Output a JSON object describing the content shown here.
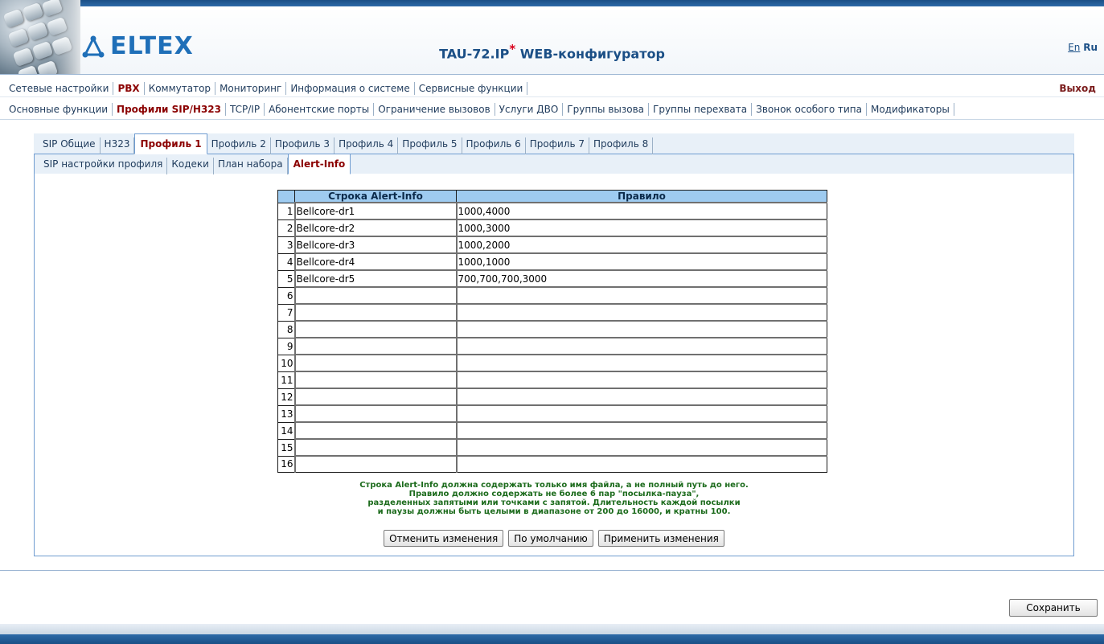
{
  "header": {
    "logo_text": "ELTEX",
    "title": "TAU-72.IP",
    "title_mark": "*",
    "title_suffix": " WEB-конфигуратор",
    "lang_en": "En",
    "lang_ru": "Ru"
  },
  "menu_main": {
    "items": [
      "Сетевые настройки",
      "PBX",
      "Коммутатор",
      "Мониторинг",
      "Информация о системе",
      "Сервисные функции"
    ],
    "active": "PBX",
    "logout": "Выход"
  },
  "menu_sub": {
    "items": [
      "Основные функции",
      "Профили SIP/H323",
      "TCP/IP",
      "Абонентские порты",
      "Ограничение вызовов",
      "Услуги ДВО",
      "Группы вызова",
      "Группы перехвата",
      "Звонок особого типа",
      "Модификаторы"
    ],
    "active": "Профили SIP/H323"
  },
  "tabs_profiles": {
    "items": [
      "SIP Общие",
      "H323",
      "Профиль 1",
      "Профиль 2",
      "Профиль 3",
      "Профиль 4",
      "Профиль 5",
      "Профиль 6",
      "Профиль 7",
      "Профиль 8"
    ],
    "active": "Профиль 1"
  },
  "tabs_profile": {
    "items": [
      "SIP настройки профиля",
      "Кодеки",
      "План набора",
      "Alert-Info"
    ],
    "active": "Alert-Info"
  },
  "table": {
    "headers": [
      "",
      "Строка Alert-Info",
      "Правило"
    ],
    "rows": [
      {
        "num": "1",
        "alert": "Bellcore-dr1",
        "rule": "1000,4000"
      },
      {
        "num": "2",
        "alert": "Bellcore-dr2",
        "rule": "1000,3000"
      },
      {
        "num": "3",
        "alert": "Bellcore-dr3",
        "rule": "1000,2000"
      },
      {
        "num": "4",
        "alert": "Bellcore-dr4",
        "rule": "1000,1000"
      },
      {
        "num": "5",
        "alert": "Bellcore-dr5",
        "rule": "700,700,700,3000"
      },
      {
        "num": "6",
        "alert": "",
        "rule": ""
      },
      {
        "num": "7",
        "alert": "",
        "rule": ""
      },
      {
        "num": "8",
        "alert": "",
        "rule": ""
      },
      {
        "num": "9",
        "alert": "",
        "rule": ""
      },
      {
        "num": "10",
        "alert": "",
        "rule": ""
      },
      {
        "num": "11",
        "alert": "",
        "rule": ""
      },
      {
        "num": "12",
        "alert": "",
        "rule": ""
      },
      {
        "num": "13",
        "alert": "",
        "rule": ""
      },
      {
        "num": "14",
        "alert": "",
        "rule": ""
      },
      {
        "num": "15",
        "alert": "",
        "rule": ""
      },
      {
        "num": "16",
        "alert": "",
        "rule": ""
      }
    ]
  },
  "hint": {
    "lines": [
      "Строка Alert-Info должна содержать только имя файла, а не полный путь до него.",
      "Правило должно содержать не более 6 пар \"посылка-пауза\",",
      "разделенных запятыми или точками с запятой. Длительность каждой посылки",
      "и паузы должны быть целыми в диапазоне от 200 до 16000, и кратны 100."
    ]
  },
  "buttons": {
    "cancel": "Отменить изменения",
    "default": "По умолчанию",
    "apply": "Применить изменения",
    "save": "Сохранить"
  },
  "colors": {
    "accent": "#1b4f86",
    "active_tab": "#8b0000",
    "table_header": "#9ecbf0",
    "hint_text": "#1c6b1c"
  }
}
